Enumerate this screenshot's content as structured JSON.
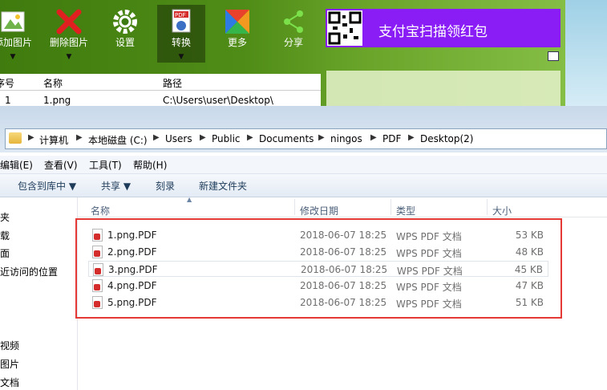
{
  "toolbar": {
    "buttons": [
      {
        "label": "添加图片",
        "icon": "add-image-icon",
        "caret": "▼"
      },
      {
        "label": "删除图片",
        "icon": "delete-x-icon",
        "caret": "▼"
      },
      {
        "label": "设置",
        "icon": "gear-icon"
      },
      {
        "label": "转换",
        "icon": "pdf-convert-icon",
        "caret": "▼"
      },
      {
        "label": "更多",
        "icon": "more-colorful-icon"
      },
      {
        "label": "分享",
        "icon": "share-icon"
      }
    ],
    "promo_text": "支付宝扫描领红包",
    "accent": "#8a1df5"
  },
  "app_list": {
    "headers": [
      "序号",
      "名称",
      "路径"
    ],
    "row1": {
      "index": "1",
      "name": "1.png",
      "path": "C:\\Users\\user\\Desktop\\"
    }
  },
  "explorer": {
    "breadcrumbs": [
      "计算机",
      "本地磁盘 (C:)",
      "Users",
      "Public",
      "Documents",
      "ningos",
      "PDF",
      "Desktop(2)"
    ],
    "menu": [
      "编辑(E)",
      "查看(V)",
      "工具(T)",
      "帮助(H)"
    ],
    "commands": [
      "包含到库中 ▼",
      "共享 ▼",
      "刻录",
      "新建文件夹"
    ],
    "nav": [
      "夹",
      "载",
      "面",
      "近访问的位置",
      "视频",
      "图片",
      "文档"
    ],
    "columns": [
      "名称",
      "修改日期",
      "类型",
      "大小"
    ],
    "files": [
      {
        "name": "1.png.PDF",
        "date": "2018-06-07 18:25",
        "type": "WPS PDF 文档",
        "size": "53 KB"
      },
      {
        "name": "2.png.PDF",
        "date": "2018-06-07 18:25",
        "type": "WPS PDF 文档",
        "size": "48 KB"
      },
      {
        "name": "3.png.PDF",
        "date": "2018-06-07 18:25",
        "type": "WPS PDF 文档",
        "size": "45 KB"
      },
      {
        "name": "4.png.PDF",
        "date": "2018-06-07 18:25",
        "type": "WPS PDF 文档",
        "size": "47 KB"
      },
      {
        "name": "5.png.PDF",
        "date": "2018-06-07 18:25",
        "type": "WPS PDF 文档",
        "size": "51 KB"
      }
    ],
    "highlight_color": "#e53935"
  }
}
